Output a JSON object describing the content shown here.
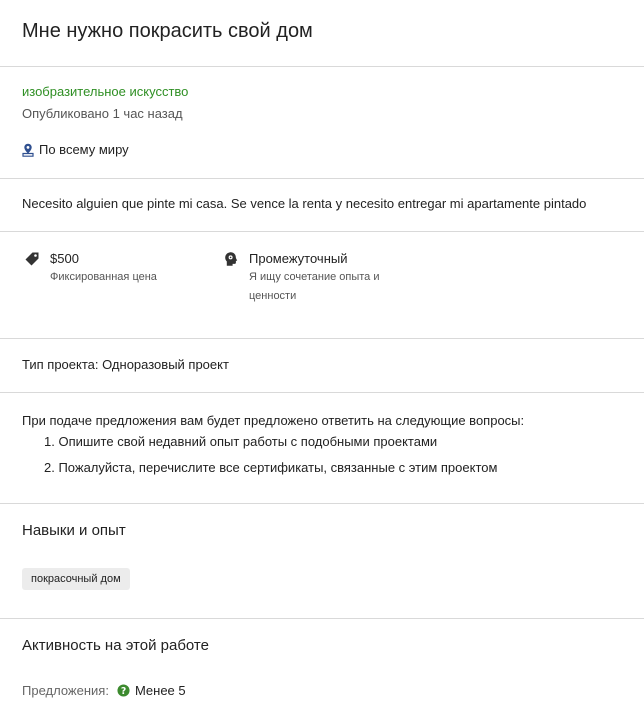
{
  "job": {
    "title": "Мне нужно покрасить свой дом",
    "category": "изобразительное искусство",
    "posted": "Опубликовано 1 час назад",
    "location": "По всему миру",
    "description": "Necesito alguien que pinte mi casa. Se vence la renta y necesito entregar mi apartamente pintado"
  },
  "features": {
    "price": {
      "icon": "price-tag-icon",
      "value": "$500",
      "label": "Фиксированная цена"
    },
    "level": {
      "icon": "head-brain-icon",
      "value": "Промежуточный",
      "label_line1": "Я ищу сочетание опыта и",
      "label_line2": "ценности"
    }
  },
  "project_type": "Тип проекта: Одноразовый проект",
  "questions": {
    "intro": "При подаче предложения вам будет предложено ответить на следующие вопросы:",
    "items": [
      "1. Опишите свой недавний опыт работы с подобными проектами",
      "2. Пожалуйста, перечислите все сертификаты, связанные с этим проектом"
    ]
  },
  "skills": {
    "heading": "Навыки и опыт",
    "items": [
      "покрасочный дом"
    ]
  },
  "activity": {
    "heading": "Активность на этой работе",
    "proposals_label": "Предложения:",
    "proposals_value": "Менее 5",
    "proposals_icon": "question-circle-icon"
  },
  "colors": {
    "accent_green": "#2f8f24",
    "location_pin_blue": "#2f4f8f",
    "divider": "#d9d9d9",
    "chip_bg": "#ececec"
  }
}
